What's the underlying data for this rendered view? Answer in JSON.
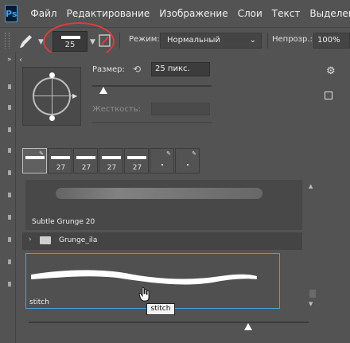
{
  "app": {
    "logo_text": "Ps"
  },
  "menu": [
    "Файл",
    "Редактирование",
    "Изображение",
    "Слои",
    "Текст",
    "Выделение"
  ],
  "options_bar": {
    "brush_size": "25",
    "mode_label": "Режим:",
    "mode_value": "Нормальный",
    "opacity_label": "Непрозр.:",
    "opacity_value": "100%"
  },
  "brush_panel": {
    "size_label": "Размер:",
    "size_value": "25 пикс.",
    "hardness_label": "Жесткость:",
    "recent_brushes": [
      {
        "label": "",
        "type": "bar",
        "selected": true
      },
      {
        "label": "27",
        "type": "bar",
        "selected": false
      },
      {
        "label": "27",
        "type": "bar",
        "selected": false
      },
      {
        "label": "27",
        "type": "bar",
        "selected": false
      },
      {
        "label": "27",
        "type": "bar",
        "selected": false
      },
      {
        "label": "",
        "type": "dot",
        "selected": false
      },
      {
        "label": "",
        "type": "dot",
        "selected": false
      }
    ],
    "list": {
      "grunge_brush_name": "Subtle Grunge 20",
      "group_name": "Grunge_ila",
      "selected_brush_name": "stitch"
    },
    "tooltip": "stitch"
  },
  "colors": {
    "accent_highlight": "#e23b3b",
    "selection_border": "#49a2d8",
    "panel_bg": "#535353"
  }
}
